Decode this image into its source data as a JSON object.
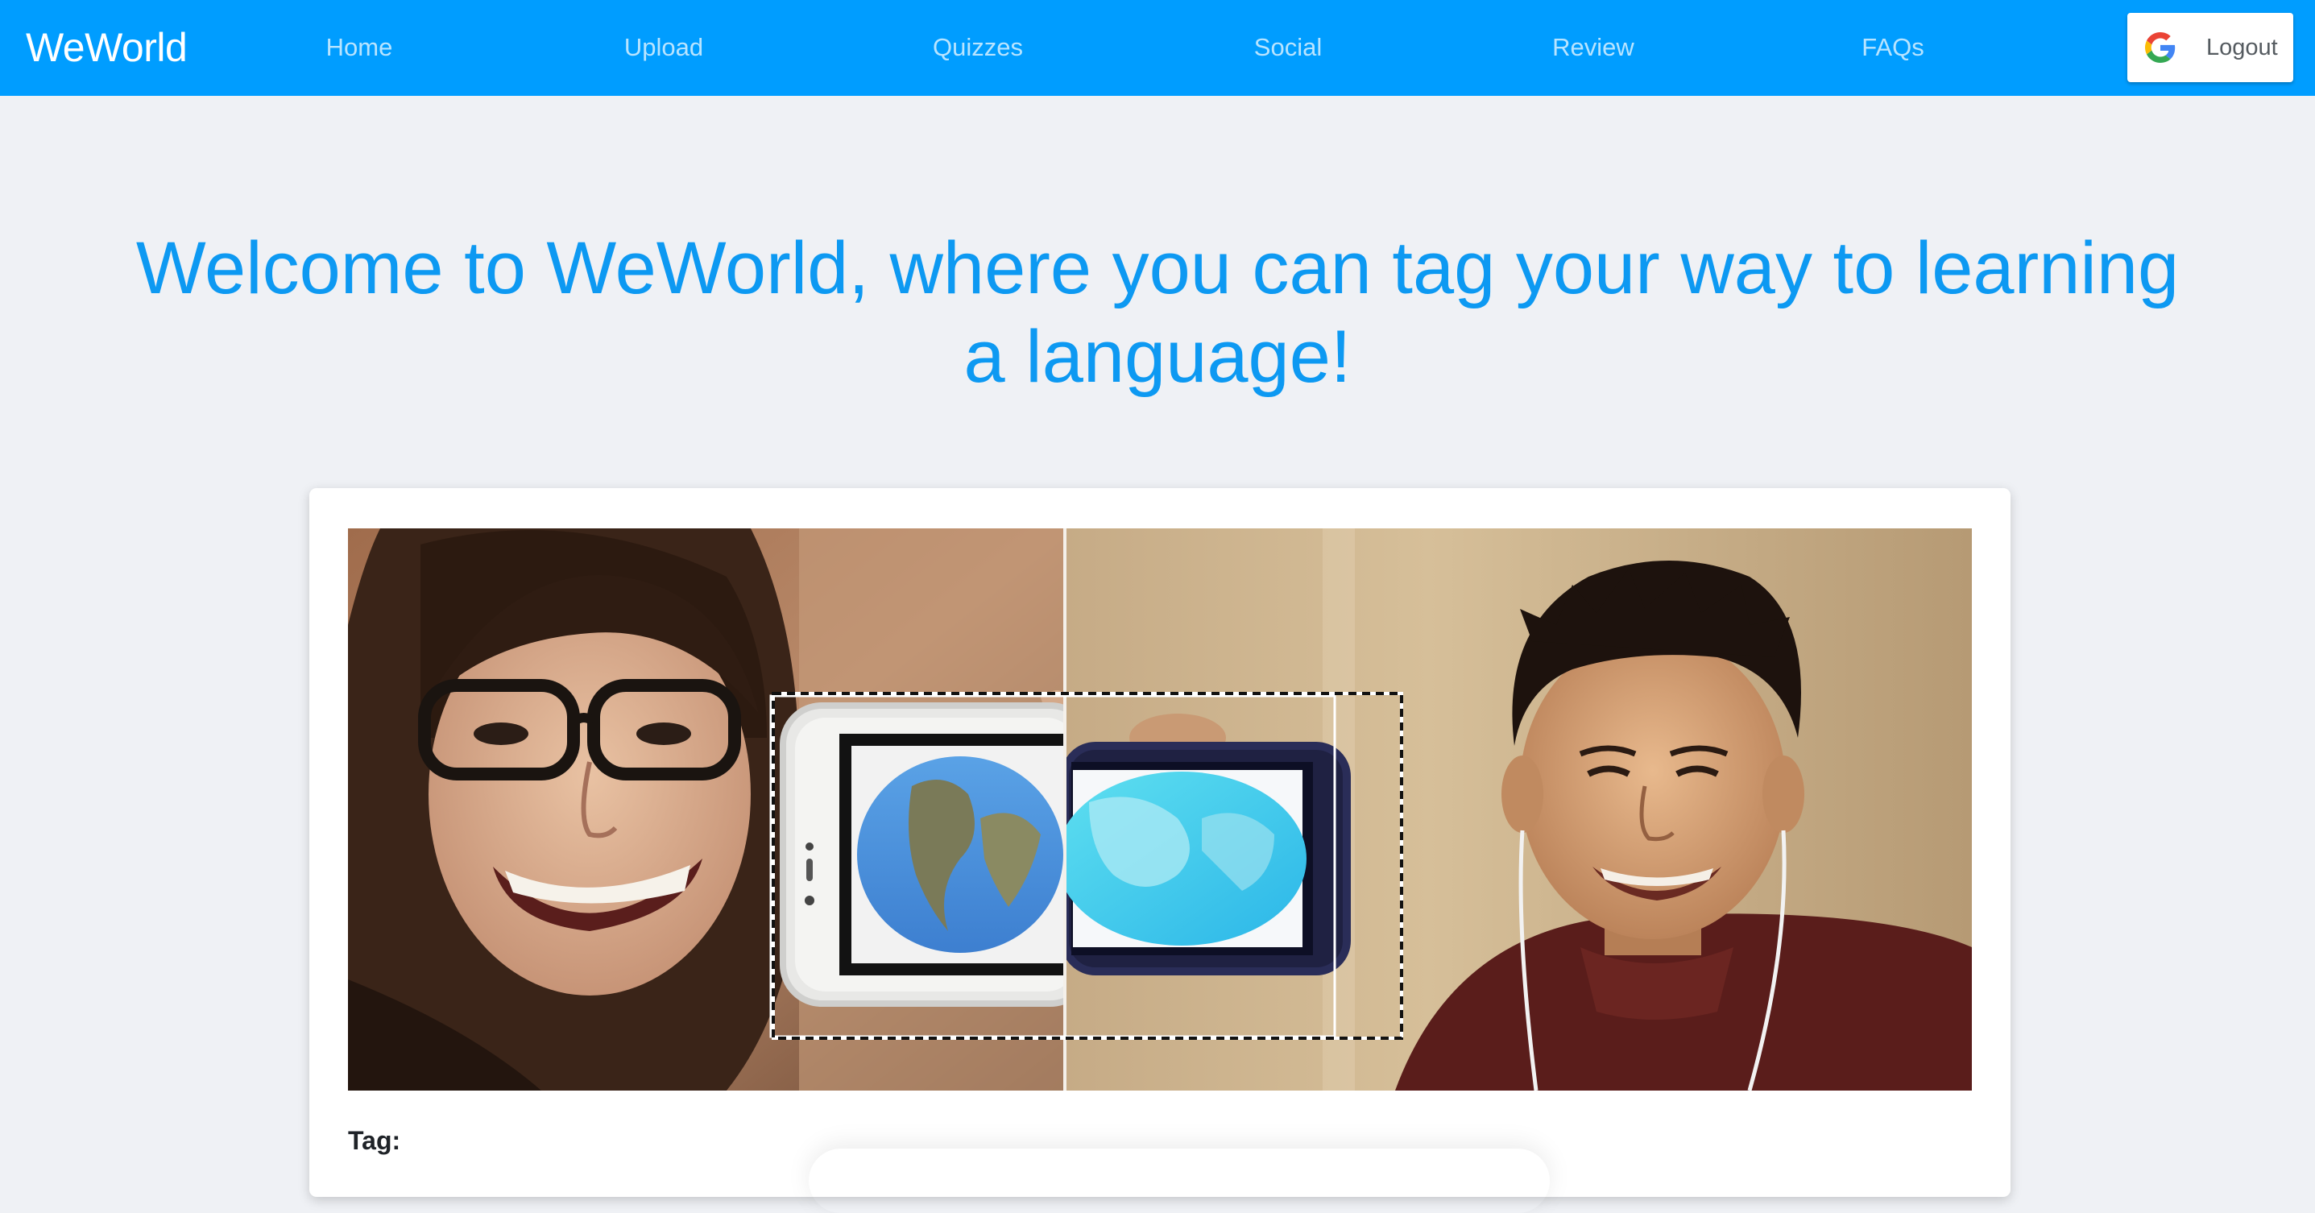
{
  "app": {
    "brand": "WeWorld"
  },
  "nav": {
    "items": [
      {
        "label": "Home"
      },
      {
        "label": "Upload"
      },
      {
        "label": "Quizzes"
      },
      {
        "label": "Social"
      },
      {
        "label": "Review"
      },
      {
        "label": "FAQs"
      }
    ],
    "logout_label": "Logout",
    "logout_icon": "google-g-icon"
  },
  "hero": {
    "title": "Welcome to WeWorld, where you can tag your way to learning a language!"
  },
  "card": {
    "tag_label": "Tag:"
  },
  "colors": {
    "navbar": "#009dff",
    "accent": "#0d99f2",
    "background": "#eff1f5"
  }
}
